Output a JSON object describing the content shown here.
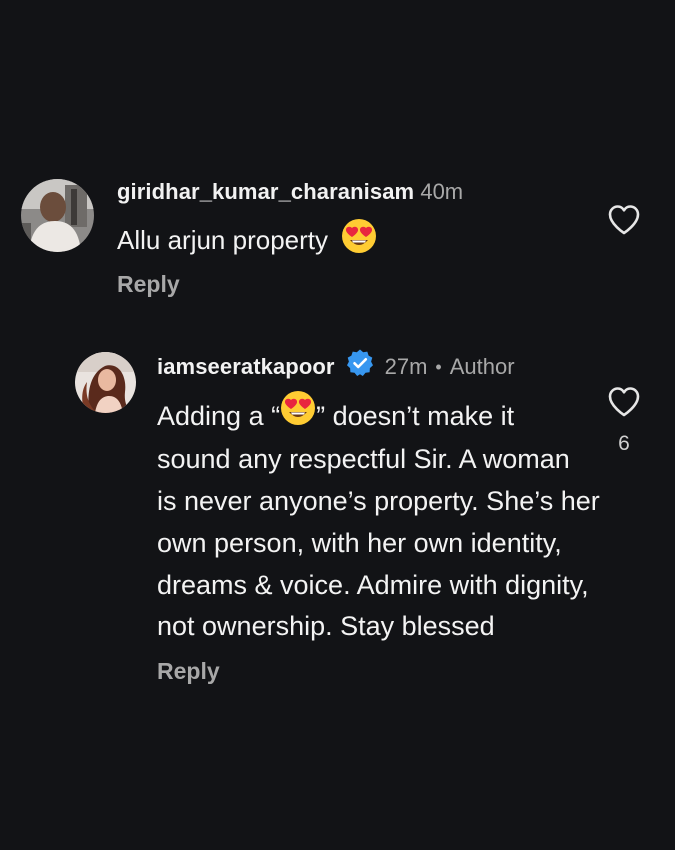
{
  "comments": [
    {
      "username": "giridhar_kumar_charanisam",
      "time": "40m",
      "text_before_emoji": "Allu arjun property",
      "emoji": "heart-eyes-emoji",
      "reply_label": "Reply"
    },
    {
      "username": "iamseeratkapoor",
      "verified": true,
      "time": "27m",
      "separator": "•",
      "author_label": "Author",
      "lines": [
        {
          "before": "Adding a “",
          "emoji": "heart-eyes-emoji",
          "after": "” doesn’t make it"
        },
        {
          "text": "sound any respectful Sir. A woman"
        },
        {
          "text": "is never anyone’s property. She’s her"
        },
        {
          "text": "own person, with her own identity,"
        },
        {
          "text": "dreams & voice. Admire with dignity,"
        },
        {
          "text": "not ownership. Stay blessed"
        }
      ],
      "likes": "6",
      "reply_label": "Reply"
    }
  ],
  "colors": {
    "background": "#121316",
    "verified_badge": "#3797f0",
    "secondary_text": "#a8a8a8"
  }
}
